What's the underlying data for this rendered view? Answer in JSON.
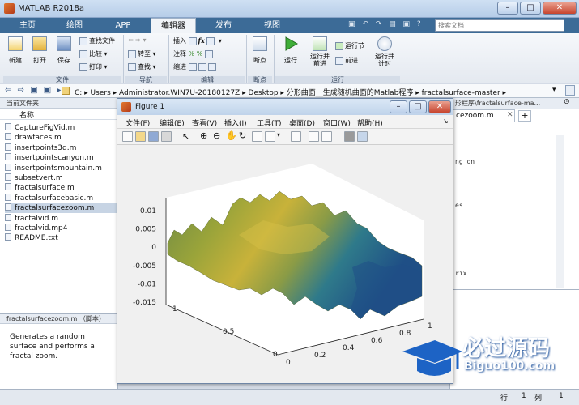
{
  "app": {
    "title": "MATLAB R2018a"
  },
  "window_buttons": {
    "minimize": "–",
    "maximize": "□",
    "close": "✕"
  },
  "tabs": [
    {
      "label": "主页"
    },
    {
      "label": "绘图"
    },
    {
      "label": "APP"
    },
    {
      "label": "编辑器"
    },
    {
      "label": "发布"
    },
    {
      "label": "视图"
    }
  ],
  "search": {
    "placeholder": "搜索文档"
  },
  "ribbon": {
    "file": {
      "new": "新建",
      "open": "打开",
      "save": "保存",
      "find_files": "查找文件",
      "compare": "比较",
      "print": "打印",
      "group": "文件"
    },
    "navigate": {
      "goto": "转至",
      "find": "查找",
      "group": "导航"
    },
    "edit": {
      "insert": "插入",
      "comment": "注释",
      "indent": "缩进",
      "group": "编辑"
    },
    "breakpoints": {
      "label": "断点",
      "group": "断点"
    },
    "run": {
      "run": "运行",
      "run_advance": "运行并\n前进",
      "run_section": "运行节",
      "advance": "前进",
      "run_time": "运行并\n计时",
      "group": "运行"
    }
  },
  "address": {
    "path": "C: ▸ Users ▸ Administrator.WIN7U-20180127Z ▸ Desktop ▸ 分形曲面__生成随机曲面的Matlab程序 ▸ fractalsurface-master ▸"
  },
  "file_panel": {
    "title": "当前文件夹",
    "column": "名称",
    "files": [
      {
        "name": "CaptureFigVid.m"
      },
      {
        "name": "drawfaces.m"
      },
      {
        "name": "insertpoints3d.m"
      },
      {
        "name": "insertpointscanyon.m"
      },
      {
        "name": "insertpointsmountain.m"
      },
      {
        "name": "subsetvert.m"
      },
      {
        "name": "fractalsurface.m"
      },
      {
        "name": "fractalsurfacebasic.m"
      },
      {
        "name": "fractalsurfacezoom.m"
      },
      {
        "name": "fractalvid.m"
      },
      {
        "name": "fractalvid.mp4"
      },
      {
        "name": "README.txt"
      }
    ],
    "selected_index": 8
  },
  "details": {
    "title": "fractalsurfacezoom.m （脚本）",
    "text": "Generates a random surface and performs a fractal zoom."
  },
  "editor": {
    "path": "形程序\\fractalsurface-ma...",
    "tab": "cezoom.m",
    "code_fragments": [
      "ng on",
      "es",
      "rix"
    ]
  },
  "status": {
    "row_label": "行",
    "row": "1",
    "col_label": "列",
    "col": "1"
  },
  "figure": {
    "title": "Figure 1",
    "menu": [
      "文件(F)",
      "编辑(E)",
      "查看(V)",
      "插入(I)",
      "工具(T)",
      "桌面(D)",
      "窗口(W)",
      "帮助(H)"
    ],
    "z_ticks": [
      "0.01",
      "0.005",
      "0",
      "-0.005",
      "-0.01",
      "-0.015"
    ],
    "x_ticks": [
      "0",
      "0.5",
      "1"
    ],
    "y_ticks": [
      "0",
      "0.2",
      "0.4",
      "0.6",
      "0.8",
      "1"
    ]
  },
  "watermark": {
    "brand": "必过源码",
    "site": "Biguo100.com"
  },
  "colors": {
    "tab_bar": "#3c6b97",
    "surface_high": "#c8b23a",
    "surface_low": "#1f5a86"
  }
}
